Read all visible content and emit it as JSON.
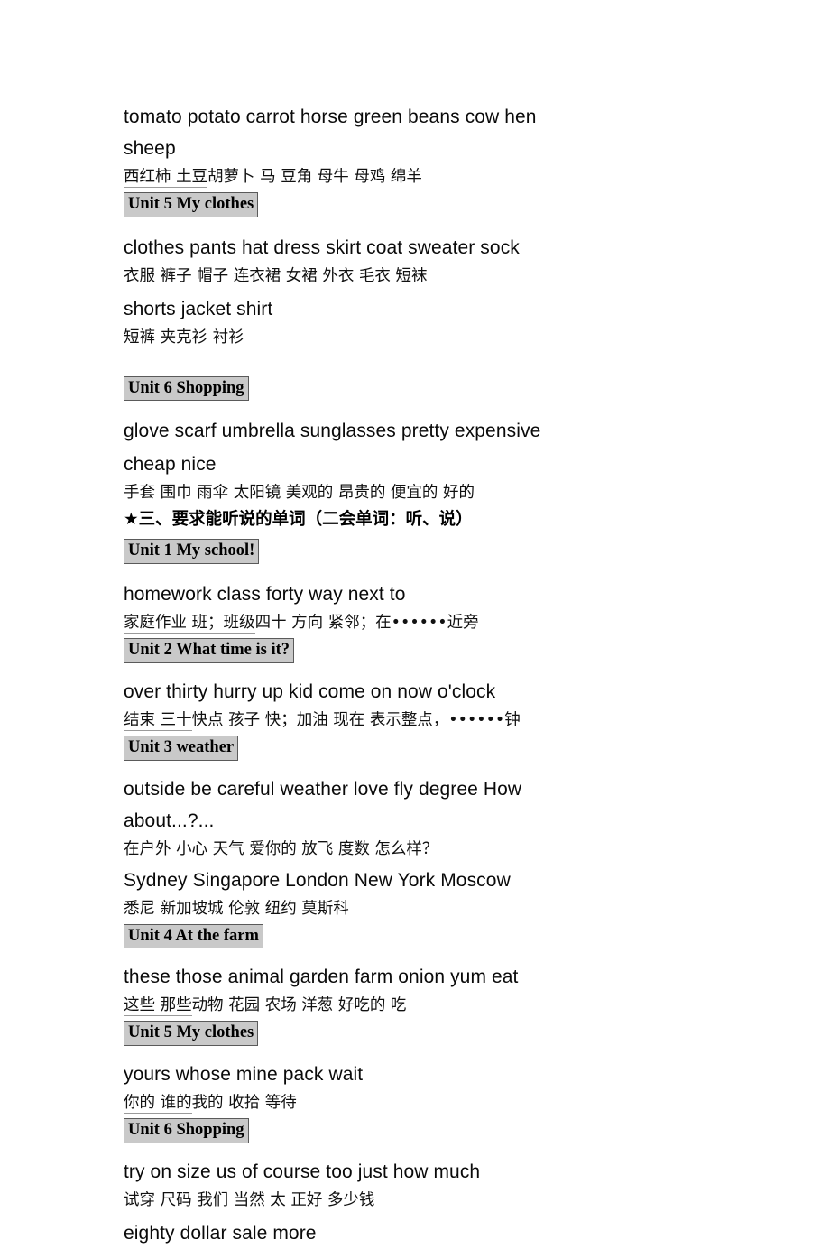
{
  "document": {
    "type": "vocabulary-list",
    "language_pair": "English-Chinese"
  },
  "blocks": {
    "produce_en_1": "tomato      potato      carrot      horse      green beans   cow      hen",
    "produce_en_2": "sheep",
    "produce_cn": {
      "underlined": "西红柿      土豆",
      "rest": "      胡萝卜        马               豆角       母牛  母鸡   绵羊"
    },
    "unit5_heading_a": "Unit 5 My clothes",
    "clothes_en_1": "clothes     pants    hat    dress    skirt    coat    sweater    sock",
    "clothes_cn_1": " 衣服       裤子   帽子  连衣裙   女裙     外衣     毛衣       短袜",
    "clothes_en_2": "shorts    jacket    shirt",
    "clothes_cn_2": "短裤      夹克衫   衬衫",
    "unit6_heading_a": "Unit 6 Shopping",
    "shopping_en_1": "glove        scarf       umbrella    sunglasses    pretty      expensive",
    "shopping_en_2": "cheap    nice",
    "shopping_cn": "手套     围巾     雨伞         太阳镜      美观的      昂贵的     便宜的   好的",
    "section_heading": "★三、要求能听说的单词（二会单词：听、说）",
    "unit1_heading": "Unit 1 My school!",
    "unit1_en": "homework        class        forty     way       next to",
    "unit1_cn": {
      "underlined": "家庭作业        班；班级",
      "rest": "     四十      方向     紧邻；在••••••近旁"
    },
    "unit2_heading": "Unit 2 What time is it?",
    "unit2_en": "over     thirty    hurry up   kid    come on     now         o'clock",
    "unit2_cn": {
      "underlined": "结束    三十",
      "rest": "          快点    孩子    快；加油     现在     表示整点，••••••钟"
    },
    "unit3_heading": "Unit 3 weather",
    "unit3_en_1": "outside     be careful      weather     love     fly     degree     How",
    "unit3_en_2": "about...?...",
    "unit3_cn_1": "在户外         小心           天气      爱你的  放飞    度数        怎么样？",
    "unit3_en_3": "Sydney     Singapore     London    New York    Moscow",
    "unit3_cn_2": " 悉尼         新加坡城        伦敦           纽约          莫斯科",
    "unit4_heading": "Unit 4 At the farm",
    "unit4_en": "these    those    animal    garden    farm    onion    yum    eat",
    "unit4_cn": {
      "underlined": "这些     那些",
      "rest": "     动物      花园        农场    洋葱    好吃的   吃"
    },
    "unit5_heading_b": "Unit 5 My clothes",
    "unit5_en": "yours    whose    mine    pack    wait",
    "unit5_cn": {
      "underlined": "你的      谁的",
      "rest": "    我的    收拾    等待"
    },
    "unit6_heading_b": "Unit 6 Shopping",
    "unit6_en_1": "try on     size     us    of course    too     just    how much",
    "unit6_cn_1": "试穿      尺码   我们     当然      太      正好     多少钱",
    "unit6_en_2": "eighty     dollar     sale     more"
  }
}
